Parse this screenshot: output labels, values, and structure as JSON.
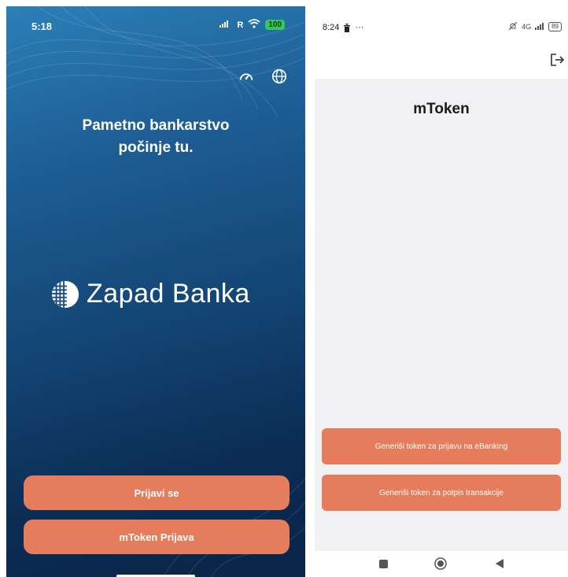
{
  "left_screen": {
    "status_bar": {
      "time": "5:18",
      "signal": "R",
      "battery": "100"
    },
    "top_icons": [
      "speedometer-icon",
      "globe-icon"
    ],
    "headline_line1": "Pametno bankarstvo",
    "headline_line2": "počinje tu.",
    "logo_text": "Zapad Banka",
    "buttons": {
      "login": "Prijavi se",
      "mtoken_login": "mToken Prijava"
    },
    "colors": {
      "button": "#e57c5b",
      "background_top": "#2c7fb8",
      "background_bottom": "#0a2547"
    }
  },
  "right_screen": {
    "status_bar": {
      "time": "8:24",
      "more": "···",
      "network": "4G",
      "battery": "89"
    },
    "title": "mToken",
    "buttons": {
      "generate_ebanking": "Generiši token za prijavu na eBanking",
      "generate_transaction": "Generiši token za potpis transakcije"
    },
    "header_icons": [
      "logout-icon"
    ],
    "nav_icons": [
      "recents-icon",
      "home-icon",
      "back-icon"
    ],
    "colors": {
      "button": "#e57c5b",
      "background": "#f1f1f3"
    }
  }
}
